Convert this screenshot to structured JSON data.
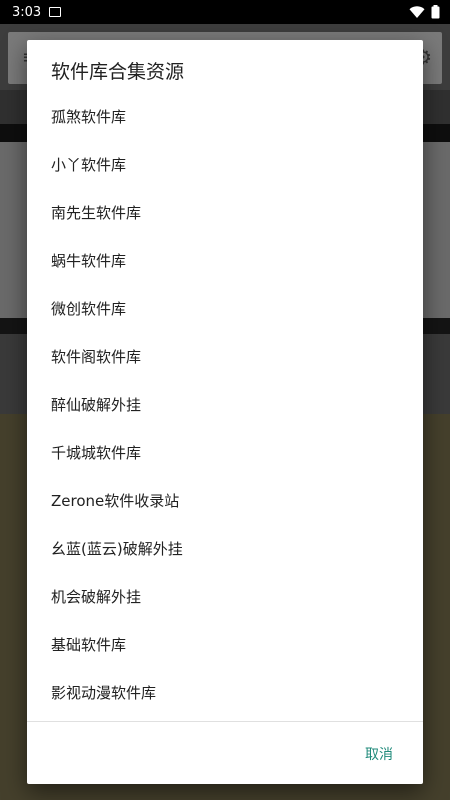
{
  "status_bar": {
    "time": "3:03",
    "icons": [
      "image-icon",
      "wifi-icon",
      "battery-icon"
    ]
  },
  "background": {
    "menu_icon": "menu-icon",
    "settings_icon": "gear-icon"
  },
  "dialog": {
    "title": "软件库合集资源",
    "items": [
      {
        "label": "孤煞软件库"
      },
      {
        "label": "小丫软件库"
      },
      {
        "label": "南先生软件库"
      },
      {
        "label": "蜗牛软件库"
      },
      {
        "label": "微创软件库"
      },
      {
        "label": "软件阁软件库"
      },
      {
        "label": "醉仙破解外挂"
      },
      {
        "label": "千城城软件库"
      },
      {
        "label": "Zerone软件收录站"
      },
      {
        "label": "幺蓝(蓝云)破解外挂"
      },
      {
        "label": "机会破解外挂"
      },
      {
        "label": "基础软件库"
      },
      {
        "label": "影视动漫软件库"
      }
    ],
    "cancel_label": "取消",
    "accent_color": "#1f8a7a"
  }
}
